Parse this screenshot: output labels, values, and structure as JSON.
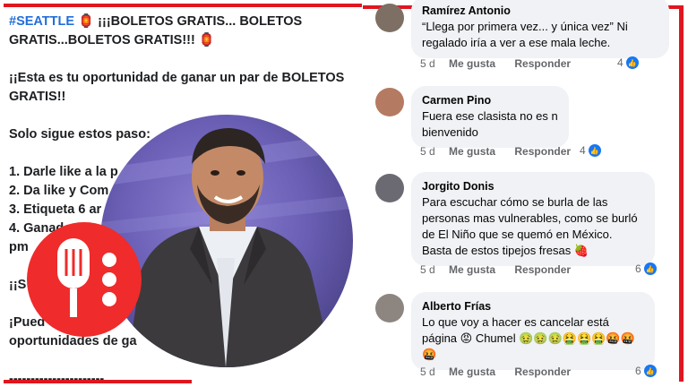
{
  "post": {
    "hashtag": "#SEATTLE",
    "headline": "¡¡¡BOLETOS GRATIS... BOLETOS GRATIS...BOLETOS GRATIS!!!",
    "line2": "¡¡Esta es tu oportunidad de ganar un par de BOLETOS GRATIS!!",
    "line3": "Solo sigue estos paso:",
    "steps": [
      "1. Darle like a la p",
      "2. Da like y Com",
      "3. Etiqueta 6 ar",
      "4. Ganad",
      "pm"
    ],
    "line4": "¡¡S",
    "line5": "¡Pued",
    "line6": "oportunidades de ga",
    "divider": "----------------------"
  },
  "comments": [
    {
      "author": "Ramírez Antonio",
      "text": "“Llega por primera vez... y única vez” Ni regalado iría a ver a ese mala leche.",
      "time": "5 d",
      "like": "Me gusta",
      "reply": "Responder",
      "count": "4"
    },
    {
      "author": "Carmen Pino",
      "text": "Fuera ese clasista no es n bienvenido",
      "time": "5 d",
      "like": "Me gusta",
      "reply": "Responder",
      "count": "4"
    },
    {
      "author": "Jorgito Donis",
      "text": "Para escuchar cómo se burla de las personas mas vulnerables, como se burló de El Niño que se quemó en México. Basta de estos tipejos fresas 🍓",
      "time": "5 d",
      "like": "Me gusta",
      "reply": "Responder",
      "count": "6"
    },
    {
      "author": "Alberto Frías",
      "text": "Lo que voy a hacer es cancelar está página 😡 Chumel 🤢🤢🤢🤮🤮🤮🤬🤬🤬",
      "time": "5 d",
      "like": "Me gusta",
      "reply": "Responder",
      "count": "6"
    }
  ],
  "colors": {
    "frame": "#e0161f",
    "hashtag": "#216fdb",
    "like": "#1877f2",
    "logo": "#ef2b2b"
  },
  "icons": {
    "like": "thumbs-up-icon",
    "logo": "microphone-icon"
  }
}
